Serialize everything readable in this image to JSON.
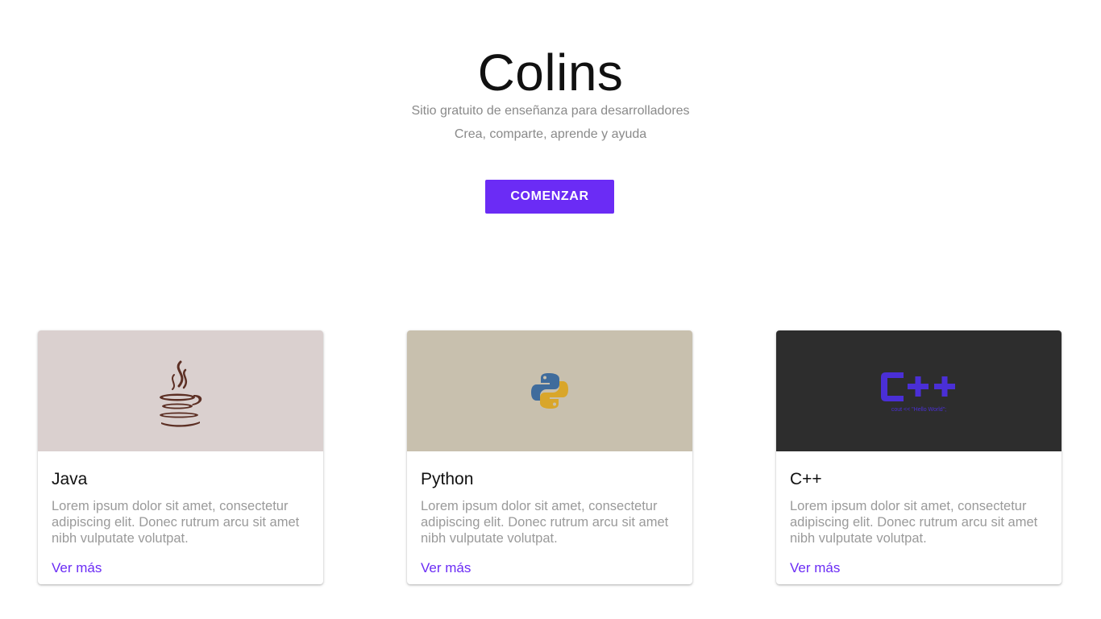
{
  "hero": {
    "title": "Colins",
    "subtitle_1": "Sitio gratuito de enseñanza para desarrolladores",
    "subtitle_2": "Crea, comparte, aprende y ayuda",
    "cta_label": "COMENZAR"
  },
  "cards": [
    {
      "title": "Java",
      "text": "Lorem ipsum dolor sit amet, consectetur adipiscing elit. Donec rutrum arcu sit amet nibh vulputate volutpat.",
      "link": "Ver más",
      "media_bg": "#dad0cf",
      "icon": "java-cup-icon"
    },
    {
      "title": "Python",
      "text": "Lorem ipsum dolor sit amet, consectetur adipiscing elit. Donec rutrum arcu sit amet nibh vulputate volutpat.",
      "link": "Ver más",
      "media_bg": "#c8c0ae",
      "icon": "python-logo-icon"
    },
    {
      "title": "C++",
      "text": "Lorem ipsum dolor sit amet, consectetur adipiscing elit. Donec rutrum arcu sit amet nibh vulputate volutpat.",
      "link": "Ver más",
      "media_bg": "#2d2d2d",
      "icon": "cpp-logo-icon",
      "icon_caption": "cout << \"Hello World\";"
    }
  ],
  "colors": {
    "accent": "#6b2cf5",
    "title_text": "#111111",
    "muted_text": "#8a8a8a"
  }
}
